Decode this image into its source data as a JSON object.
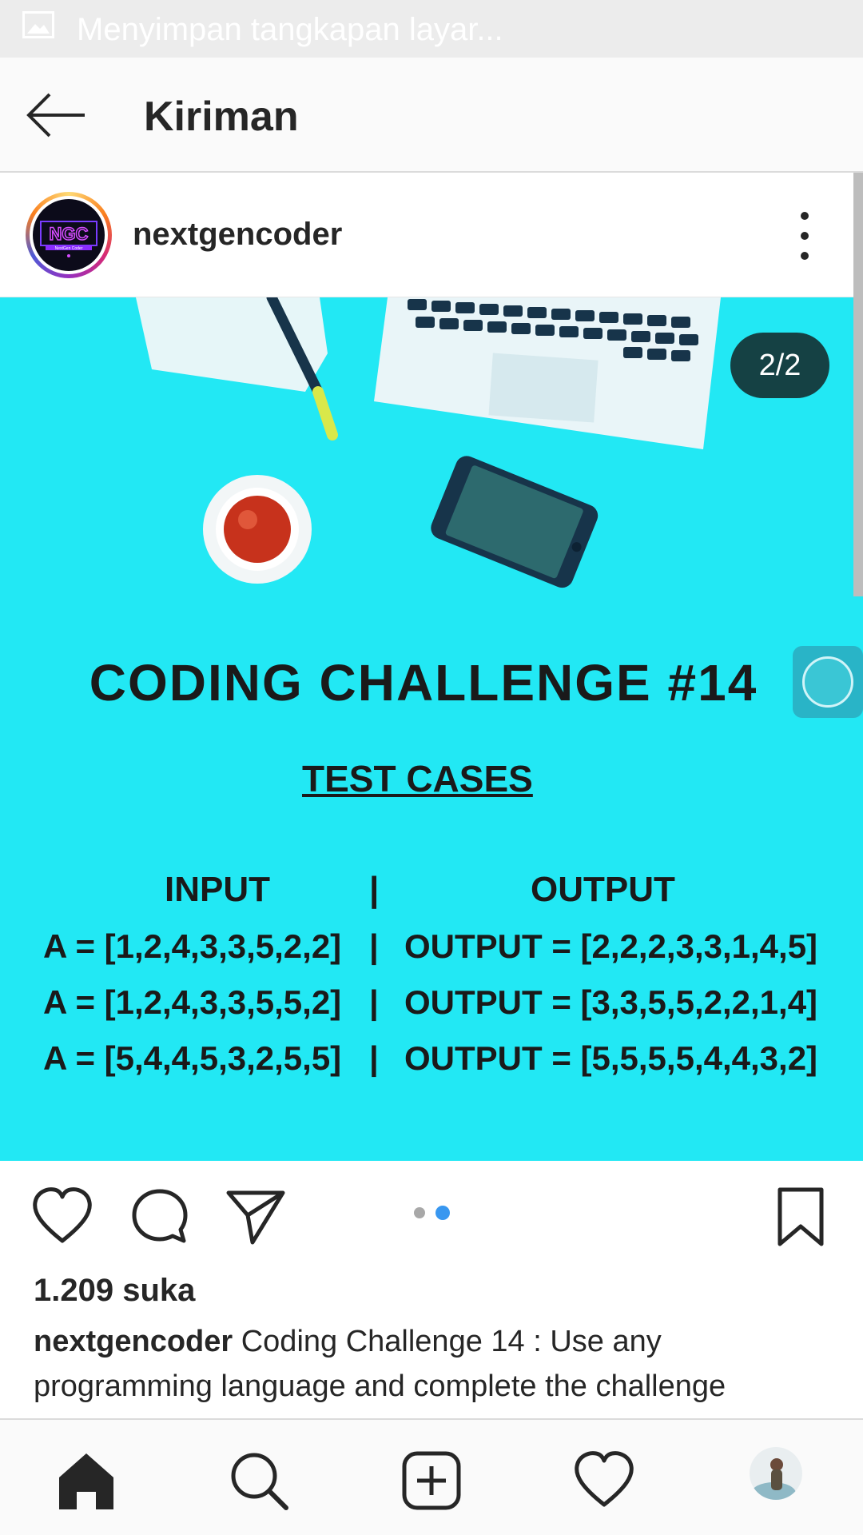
{
  "status_bar": {
    "text": "Menyimpan tangkapan layar...",
    "icon": "image-icon"
  },
  "header": {
    "title": "Kiriman",
    "back_icon": "arrow-left-icon"
  },
  "post": {
    "username": "nextgencoder",
    "avatar_logo_text": "NGC",
    "avatar_logo_subtext": "NextGen Coder",
    "page_counter": "2/2",
    "image": {
      "title": "CODING CHALLENGE  #14",
      "subtitle": "TEST CASES",
      "col_input": "INPUT",
      "col_sep": "|",
      "col_output": "OUTPUT",
      "rows": [
        {
          "input": "A = [1,2,4,3,3,5,2,2]",
          "sep": "|",
          "output": "OUTPUT = [2,2,2,3,3,1,4,5]"
        },
        {
          "input": "A = [1,2,4,3,3,5,5,2]",
          "sep": "|",
          "output": "OUTPUT = [3,3,5,5,2,2,1,4]"
        },
        {
          "input": "A = [5,4,4,5,3,2,5,5]",
          "sep": "|",
          "output": "OUTPUT = [5,5,5,5,4,4,3,2]"
        }
      ],
      "background_color": "#22e8f4"
    },
    "carousel": {
      "count": 2,
      "active_index": 1
    },
    "likes": "1.209 suka",
    "caption_user": "nextgencoder",
    "caption_text": " Coding Challenge 14 : Use any programming language and complete the challenge"
  },
  "actions": [
    "heart-icon",
    "comment-icon",
    "share-icon",
    "bookmark-icon"
  ],
  "bottom_nav": [
    "home-icon",
    "search-icon",
    "add-post-icon",
    "activity-heart-icon",
    "profile-avatar"
  ],
  "colors": {
    "accent": "#3897f0",
    "inactive_dot": "#a8a8a8"
  }
}
